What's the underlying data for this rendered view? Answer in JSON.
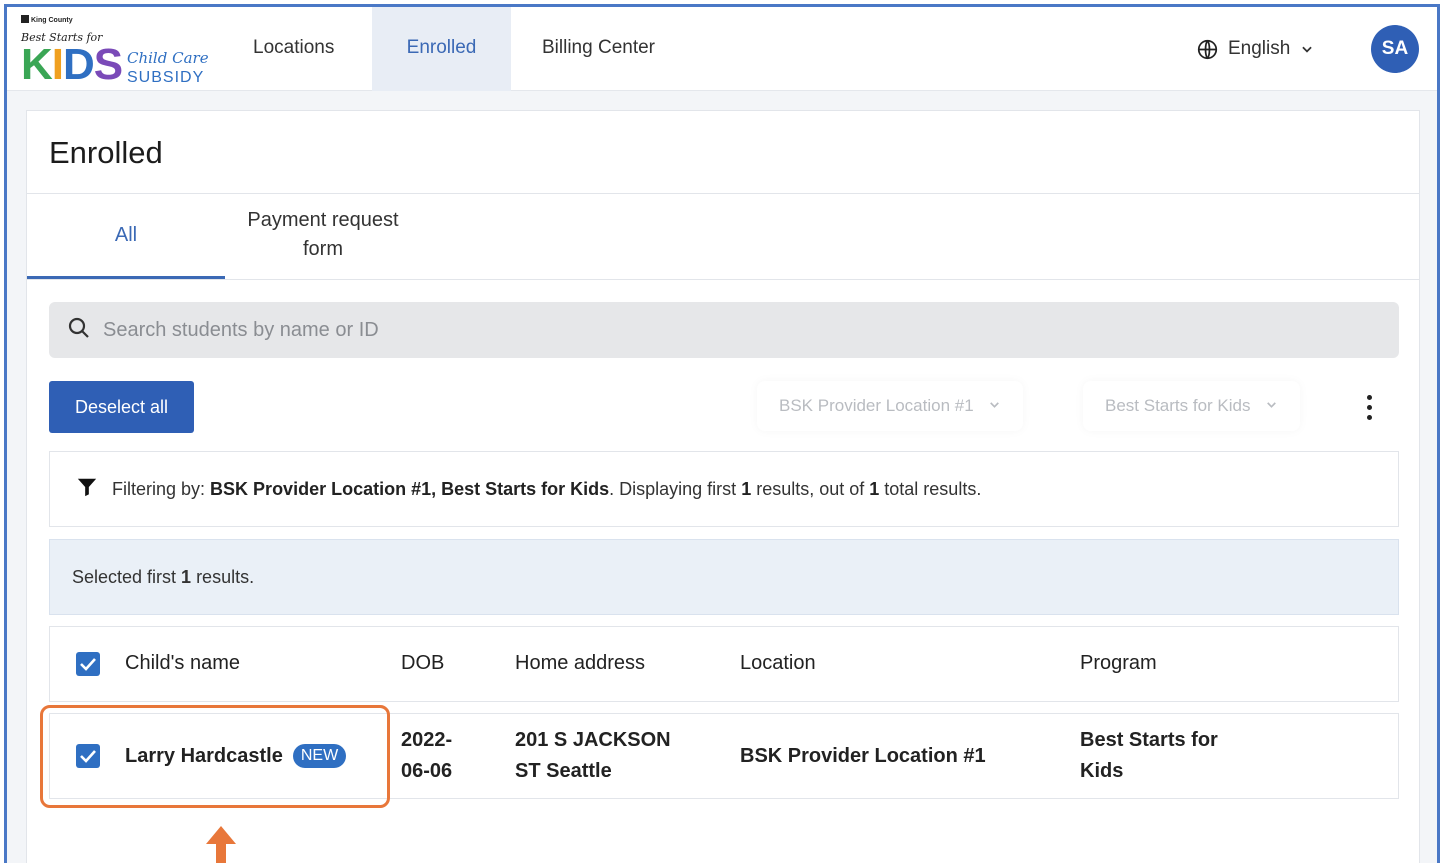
{
  "brand": {
    "county": "King County",
    "tagline": "Best Starts for",
    "kids": [
      "K",
      "I",
      "D",
      "S"
    ],
    "child_care": "Child Care",
    "subsidy": "SUBSIDY"
  },
  "nav": {
    "items": [
      {
        "label": "Locations"
      },
      {
        "label": "Enrolled",
        "active": true
      },
      {
        "label": "Billing Center"
      }
    ],
    "language": "English",
    "avatar_initials": "SA"
  },
  "page": {
    "title": "Enrolled",
    "tabs": [
      {
        "label": "All",
        "active": true
      },
      {
        "label": "Payment request form"
      }
    ]
  },
  "search": {
    "placeholder": "Search students by name or ID",
    "value": ""
  },
  "toolbar": {
    "deselect_label": "Deselect all",
    "location_filter": "BSK Provider Location #1",
    "program_filter": "Best Starts for Kids"
  },
  "filter_summary": {
    "prefix": "Filtering by: ",
    "filters": "BSK Provider Location #1, Best Starts for Kids",
    "middle": ". Displaying first ",
    "shown": "1",
    "between": " results, out of ",
    "total": "1",
    "suffix": " total results."
  },
  "selection": {
    "prefix": "Selected first ",
    "count": "1",
    "suffix": " results."
  },
  "table": {
    "columns": [
      "Child's name",
      "DOB",
      "Home address",
      "Location",
      "Program"
    ],
    "rows": [
      {
        "checked": true,
        "name": "Larry Hardcastle",
        "badge": "NEW",
        "dob_line1": "2022-",
        "dob_line2": "06-06",
        "address_line1": "201 S JACKSON",
        "address_line2": "ST Seattle",
        "location": "BSK Provider Location #1",
        "program_line1": "Best Starts for",
        "program_line2": "Kids"
      }
    ]
  },
  "colors": {
    "accent": "#2f5fb5",
    "highlight": "#e8773a",
    "selected_bg": "#eaf0f7"
  }
}
